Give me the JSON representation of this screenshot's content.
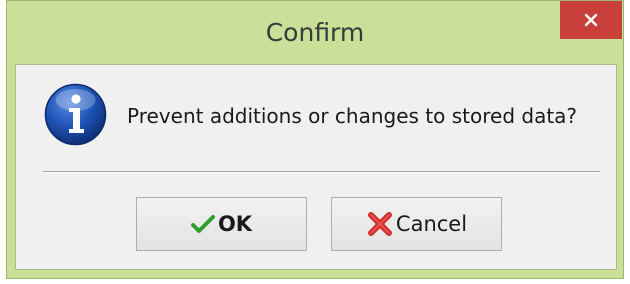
{
  "window": {
    "title": "Confirm"
  },
  "dialog": {
    "message": "Prevent additions or changes to stored data?",
    "icon": "info-icon"
  },
  "buttons": {
    "ok_label": "OK",
    "cancel_label": "Cancel"
  },
  "colors": {
    "titlebar": "#c8e098",
    "close_button": "#c9403a",
    "dialog_background": "#f0f0f0",
    "ok_icon": "#2e9e2e",
    "cancel_icon": "#d42a2a",
    "info_icon": "#1a4fa8"
  }
}
